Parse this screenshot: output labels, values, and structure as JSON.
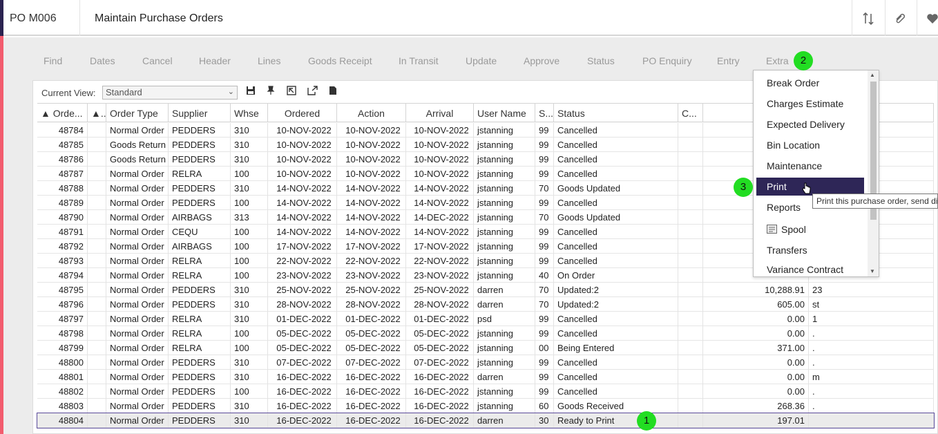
{
  "header": {
    "program_code": "PO M006",
    "title": "Maintain Purchase Orders",
    "icons": [
      "sort-arrows-icon",
      "paperclip-icon",
      "heart-icon"
    ]
  },
  "menu": [
    {
      "label": "Find"
    },
    {
      "label": "Dates"
    },
    {
      "label": "Cancel"
    },
    {
      "label": "Header"
    },
    {
      "label": "Lines"
    },
    {
      "label": "Goods Receipt"
    },
    {
      "label": "In Transit"
    },
    {
      "label": "Update"
    },
    {
      "label": "Approve"
    },
    {
      "label": "Status"
    },
    {
      "label": "PO Enquiry"
    },
    {
      "label": "Entry"
    },
    {
      "label": "Extra"
    }
  ],
  "toolbar": {
    "current_view_label": "Current View:",
    "current_view_value": "Standard",
    "icons": [
      "save-icon",
      "pin-icon",
      "restore-icon",
      "export-icon",
      "document-icon"
    ]
  },
  "table": {
    "columns": [
      "▲ Orde...",
      "▲..",
      "Order Type",
      "Supplier",
      "Whse",
      "Ordered",
      "Action",
      "Arrival",
      "User Name",
      "S...",
      "Status",
      "C...",
      "",
      ""
    ],
    "rows": [
      [
        "48784",
        "",
        "Normal Order",
        "PEDDERS",
        "310",
        "10-NOV-2022",
        "10-NOV-2022",
        "10-NOV-2022",
        "jstanning",
        "99",
        "Cancelled",
        "",
        "",
        ""
      ],
      [
        "48785",
        "",
        "Goods Return",
        "PEDDERS",
        "310",
        "10-NOV-2022",
        "10-NOV-2022",
        "10-NOV-2022",
        "jstanning",
        "99",
        "Cancelled",
        "",
        "",
        ""
      ],
      [
        "48786",
        "",
        "Goods Return",
        "PEDDERS",
        "310",
        "10-NOV-2022",
        "10-NOV-2022",
        "10-NOV-2022",
        "jstanning",
        "99",
        "Cancelled",
        "",
        "",
        ""
      ],
      [
        "48787",
        "",
        "Normal Order",
        "RELRA",
        "100",
        "10-NOV-2022",
        "10-NOV-2022",
        "10-NOV-2022",
        "jstanning",
        "99",
        "Cancelled",
        "",
        "",
        ""
      ],
      [
        "48788",
        "",
        "Normal Order",
        "PEDDERS",
        "310",
        "14-NOV-2022",
        "14-NOV-2022",
        "14-NOV-2022",
        "jstanning",
        "70",
        "Goods Updated",
        "",
        "",
        ""
      ],
      [
        "48789",
        "",
        "Normal Order",
        "PEDDERS",
        "100",
        "14-NOV-2022",
        "14-NOV-2022",
        "14-NOV-2022",
        "jstanning",
        "99",
        "Cancelled",
        "",
        "",
        ""
      ],
      [
        "48790",
        "",
        "Normal Order",
        "AIRBAGS",
        "313",
        "14-NOV-2022",
        "14-NOV-2022",
        "14-DEC-2022",
        "jstanning",
        "70",
        "Goods Updated",
        "",
        "",
        ""
      ],
      [
        "48791",
        "",
        "Normal Order",
        "CEQU",
        "100",
        "14-NOV-2022",
        "14-NOV-2022",
        "14-NOV-2022",
        "jstanning",
        "99",
        "Cancelled",
        "",
        "",
        ""
      ],
      [
        "48792",
        "",
        "Normal Order",
        "AIRBAGS",
        "100",
        "17-NOV-2022",
        "17-NOV-2022",
        "17-NOV-2022",
        "jstanning",
        "99",
        "Cancelled",
        "",
        "",
        ""
      ],
      [
        "48793",
        "",
        "Normal Order",
        "RELRA",
        "100",
        "22-NOV-2022",
        "22-NOV-2022",
        "22-NOV-2022",
        "jstanning",
        "99",
        "Cancelled",
        "",
        "",
        ""
      ],
      [
        "48794",
        "",
        "Normal Order",
        "RELRA",
        "100",
        "23-NOV-2022",
        "23-NOV-2022",
        "23-NOV-2022",
        "jstanning",
        "40",
        "On Order",
        "",
        "",
        ""
      ],
      [
        "48795",
        "",
        "Normal Order",
        "PEDDERS",
        "310",
        "25-NOV-2022",
        "25-NOV-2022",
        "25-NOV-2022",
        "darren",
        "70",
        "Updated:2",
        "",
        "10,288.91",
        "23"
      ],
      [
        "48796",
        "",
        "Normal Order",
        "PEDDERS",
        "310",
        "28-NOV-2022",
        "28-NOV-2022",
        "28-NOV-2022",
        "darren",
        "70",
        "Updated:2",
        "",
        "605.00",
        "st"
      ],
      [
        "48797",
        "",
        "Normal Order",
        "RELRA",
        "310",
        "01-DEC-2022",
        "01-DEC-2022",
        "01-DEC-2022",
        "psd",
        "99",
        "Cancelled",
        "",
        "0.00",
        "1"
      ],
      [
        "48798",
        "",
        "Normal Order",
        "RELRA",
        "100",
        "05-DEC-2022",
        "05-DEC-2022",
        "05-DEC-2022",
        "jstanning",
        "99",
        "Cancelled",
        "",
        "0.00",
        "."
      ],
      [
        "48799",
        "",
        "Normal Order",
        "RELRA",
        "100",
        "05-DEC-2022",
        "05-DEC-2022",
        "05-DEC-2022",
        "jstanning",
        "00",
        "Being Entered",
        "",
        "371.00",
        "."
      ],
      [
        "48800",
        "",
        "Normal Order",
        "PEDDERS",
        "310",
        "07-DEC-2022",
        "07-DEC-2022",
        "07-DEC-2022",
        "jstanning",
        "99",
        "Cancelled",
        "",
        "0.00",
        "."
      ],
      [
        "48801",
        "",
        "Normal Order",
        "PEDDERS",
        "310",
        "16-DEC-2022",
        "16-DEC-2022",
        "16-DEC-2022",
        "darren",
        "99",
        "Cancelled",
        "",
        "0.00",
        "m"
      ],
      [
        "48802",
        "",
        "Normal Order",
        "PEDDERS",
        "100",
        "16-DEC-2022",
        "16-DEC-2022",
        "16-DEC-2022",
        "jstanning",
        "99",
        "Cancelled",
        "",
        "0.00",
        "."
      ],
      [
        "48803",
        "",
        "Normal Order",
        "PEDDERS",
        "310",
        "16-DEC-2022",
        "16-DEC-2022",
        "16-DEC-2022",
        "jstanning",
        "60",
        "Goods Received",
        "",
        "268.36",
        "."
      ],
      [
        "48804",
        "",
        "Normal Order",
        "PEDDERS",
        "310",
        "16-DEC-2022",
        "16-DEC-2022",
        "16-DEC-2022",
        "darren",
        "30",
        "Ready to Print",
        "",
        "197.01",
        ""
      ]
    ],
    "selected_row": 20
  },
  "dropdown": {
    "items": [
      {
        "label": "Break Order"
      },
      {
        "label": "Charges Estimate"
      },
      {
        "label": "Expected Delivery"
      },
      {
        "label": "Bin Location"
      },
      {
        "label": "Maintenance"
      },
      {
        "label": "Print"
      },
      {
        "label": "Reports"
      },
      {
        "label": "Spool"
      },
      {
        "label": "Transfers"
      },
      {
        "label": "Variance Contract"
      }
    ],
    "active_index": 5
  },
  "tooltip": "Print this purchase order, send di",
  "badges": [
    "1",
    "2",
    "3"
  ],
  "colors": {
    "accent_red": "#f25c6e",
    "brand_dark": "#2e2657",
    "badge_green": "#22dd22",
    "menu_grey": "#9a9a9a"
  }
}
